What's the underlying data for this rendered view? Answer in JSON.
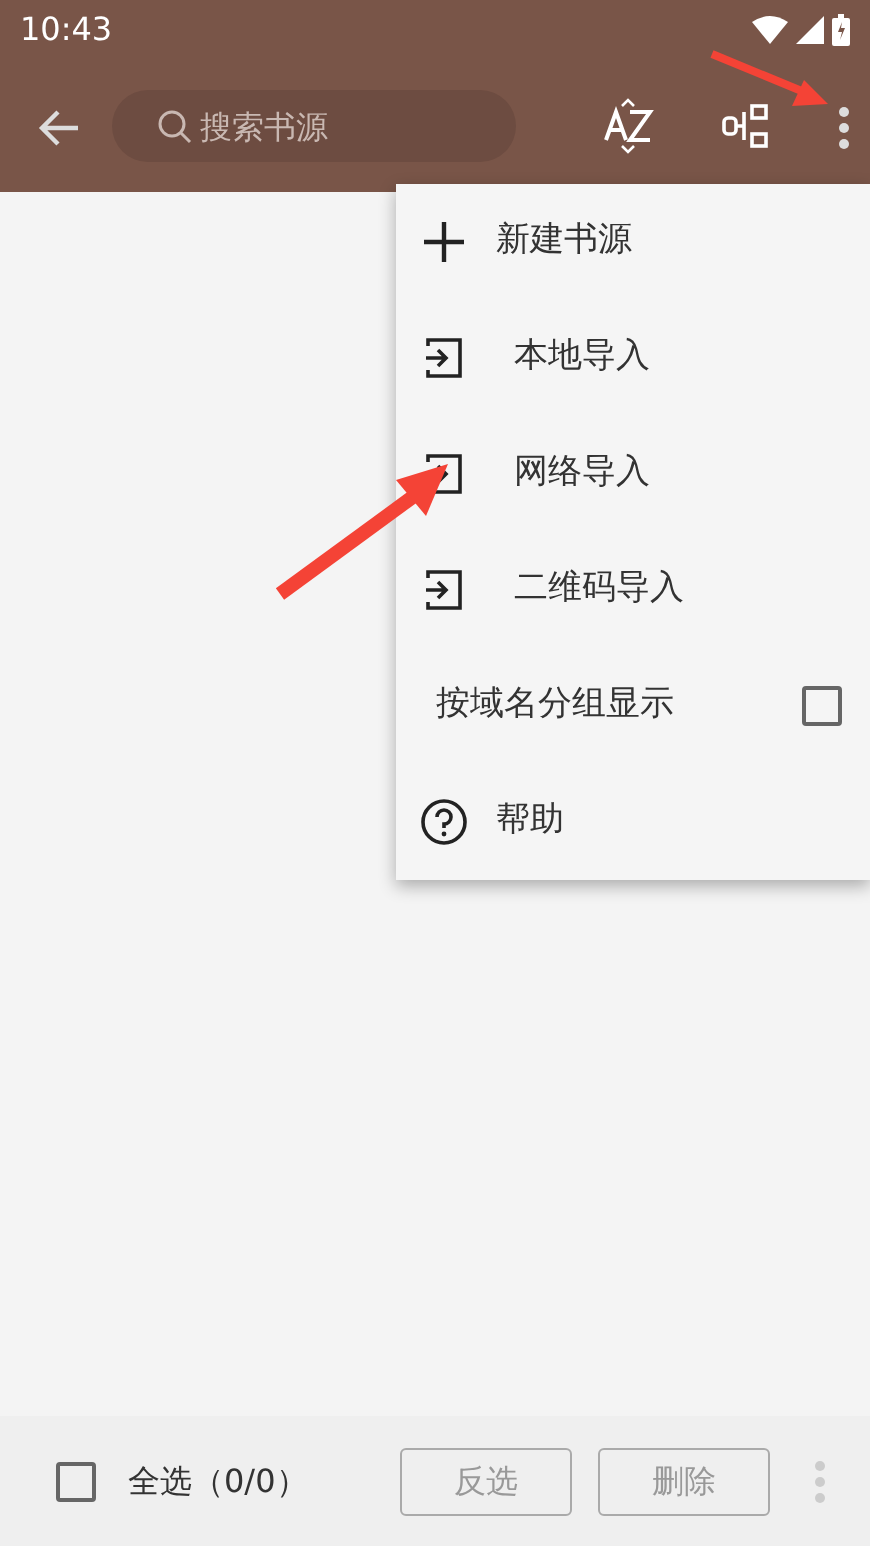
{
  "status_bar": {
    "time": "10:43"
  },
  "toolbar": {
    "search": {
      "placeholder": "搜索书源"
    }
  },
  "menu": {
    "items": [
      {
        "kind": "add",
        "label": "新建书源"
      },
      {
        "kind": "import",
        "label": "本地导入"
      },
      {
        "kind": "import",
        "label": "网络导入"
      },
      {
        "kind": "import",
        "label": "二维码导入"
      },
      {
        "kind": "checkbox",
        "label": "按域名分组显示",
        "checked": false
      },
      {
        "kind": "help",
        "label": "帮助"
      }
    ]
  },
  "bottom_bar": {
    "select_all": {
      "label": "全选（0/0）",
      "checked": false
    },
    "buttons": [
      {
        "label": "反选",
        "disabled": true
      },
      {
        "label": "删除",
        "disabled": true
      }
    ]
  }
}
